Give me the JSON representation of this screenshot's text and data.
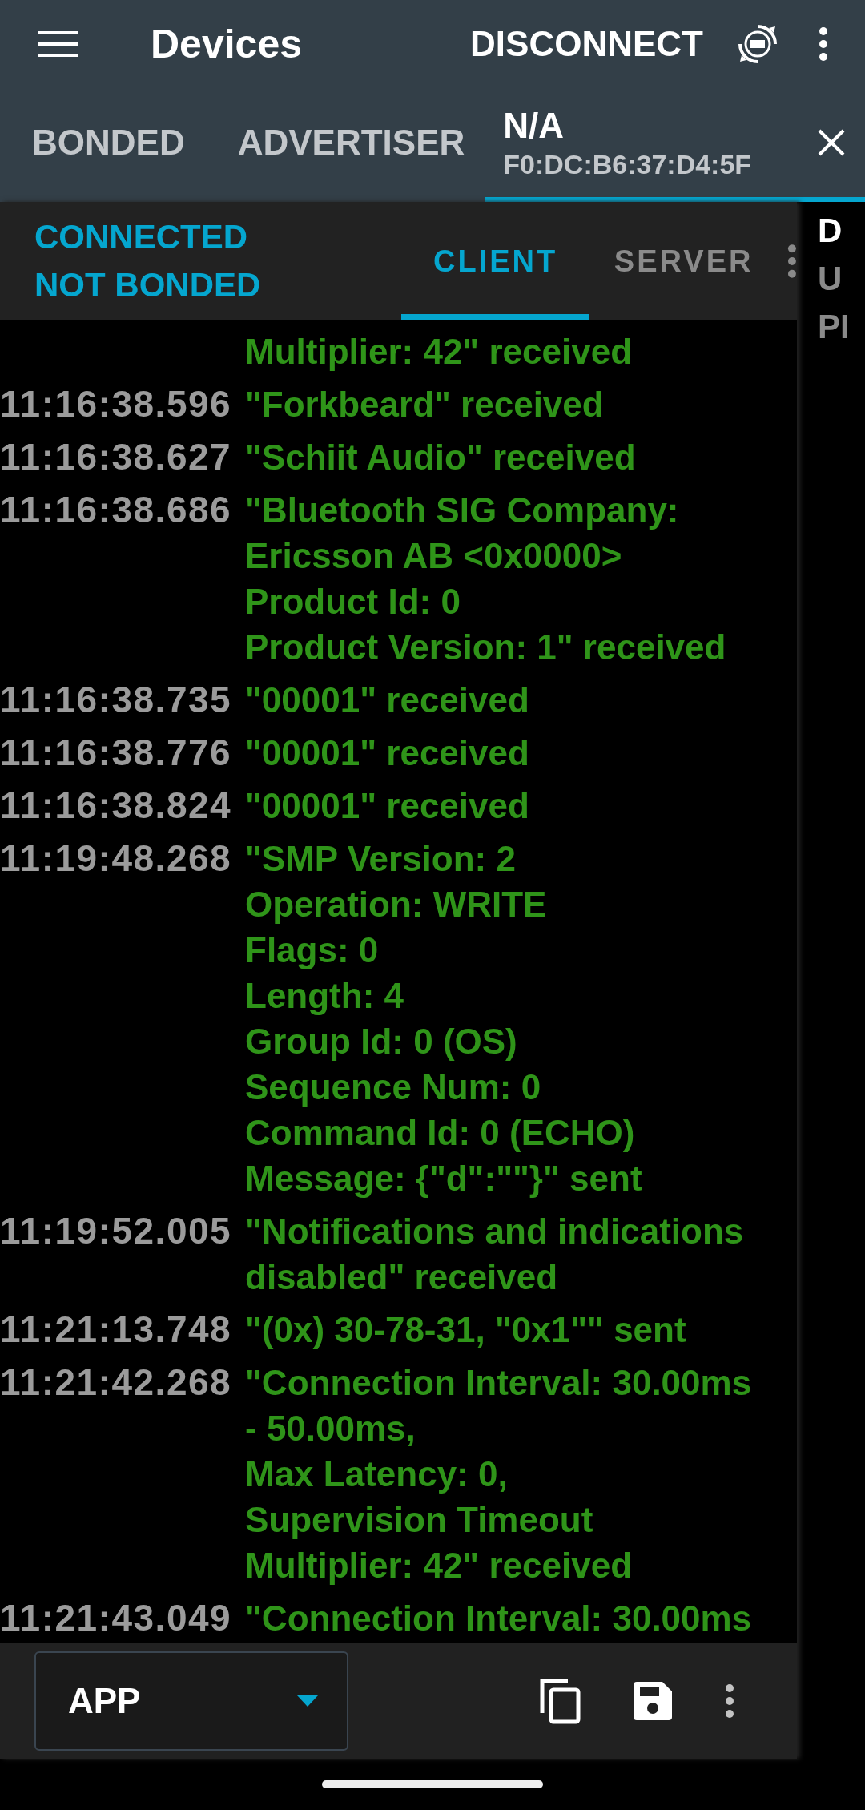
{
  "app_bar": {
    "title": "Devices",
    "action": "DISCONNECT"
  },
  "device_tabs": [
    {
      "label": "BONDED",
      "selected": false
    },
    {
      "label": "ADVERTISER",
      "selected": false
    },
    {
      "label": "N/A",
      "subtitle": "F0:DC:B6:37:D4:5F",
      "selected": true
    }
  ],
  "connection_status": [
    "CONNECTED",
    "NOT BONDED"
  ],
  "mode_tabs": [
    {
      "label": "CLIENT",
      "selected": true
    },
    {
      "label": "SERVER",
      "selected": false
    }
  ],
  "log": [
    {
      "message": "Multiplier: 42\" received"
    },
    {
      "time": "11:16:38.596",
      "message": "\"Forkbeard\" received"
    },
    {
      "time": "11:16:38.627",
      "message": "\"Schiit Audio\" received"
    },
    {
      "time": "11:16:38.686",
      "message": "\"Bluetooth SIG Company:\nEricsson AB <0x0000>\nProduct Id: 0\nProduct Version: 1\" received"
    },
    {
      "time": "11:16:38.735",
      "message": "\"00001\" received"
    },
    {
      "time": "11:16:38.776",
      "message": "\"00001\" received"
    },
    {
      "time": "11:16:38.824",
      "message": "\"00001\" received"
    },
    {
      "time": "11:19:48.268",
      "message": "\"SMP Version: 2\nOperation: WRITE\nFlags: 0\nLength: 4\nGroup Id: 0 (OS)\nSequence Num: 0\nCommand Id: 0 (ECHO)\nMessage: {\"d\":\"\"}\" sent"
    },
    {
      "time": "11:19:52.005",
      "message": "\"Notifications and indications\ndisabled\" received"
    },
    {
      "time": "11:21:13.748",
      "message": "\"(0x) 30-78-31, \"0x1\"\" sent"
    },
    {
      "time": "11:21:42.268",
      "message": "\"Connection Interval: 30.00ms\n- 50.00ms,\nMax Latency: 0,\nSupervision Timeout\nMultiplier: 42\" received"
    },
    {
      "time": "11:21:43.049",
      "message": "\"Connection Interval: 30.00ms"
    }
  ],
  "side_panel": [
    {
      "kind": "title",
      "text": "D"
    },
    {
      "kind": "field",
      "text": "U"
    },
    {
      "kind": "field",
      "text": "PI"
    }
  ],
  "log_filter": {
    "value": "APP"
  }
}
